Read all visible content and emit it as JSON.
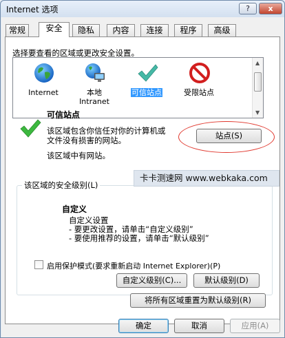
{
  "window": {
    "title": "Internet 选项",
    "help_label": "?",
    "close_label": "x"
  },
  "tabs": [
    {
      "label": "常规"
    },
    {
      "label": "安全",
      "active": true
    },
    {
      "label": "隐私"
    },
    {
      "label": "内容"
    },
    {
      "label": "连接"
    },
    {
      "label": "程序"
    },
    {
      "label": "高级"
    }
  ],
  "security": {
    "instruction": "选择要查看的区域或更改安全设置。",
    "zones": [
      {
        "icon": "globe-icon",
        "label": "Internet"
      },
      {
        "icon": "local-intranet-icon",
        "label": "本地\nIntranet"
      },
      {
        "icon": "checkmark-icon",
        "label": "可信站点",
        "selected": true
      },
      {
        "icon": "restricted-icon",
        "label": "受限站点"
      }
    ],
    "zone_title": "可信站点",
    "zone_desc_line1": "该区域包含你信任对你的计算机或",
    "zone_desc_line2": "文件没有损害的网站。",
    "zone_has_sites": "该区域中有网站。",
    "sites_button": "站点(S)",
    "group_title": "该区域的安全级别(L)",
    "level_name": "自定义",
    "level_line1": "自定义设置",
    "level_line2": "- 要更改设置，请单击“自定义级别”",
    "level_line3": "- 要使用推荐的设置，请单击“默认级别”",
    "protected_mode_label": "启用保护模式(要求重新启动 Internet Explorer)(P)",
    "protected_mode_checked": false,
    "custom_level_button": "自定义级别(C)...",
    "default_level_button": "默认级别(D)",
    "reset_all_button": "将所有区域重置为默认级别(R)"
  },
  "watermark": "卡卡测速网 www.webkaka.com",
  "footer": {
    "ok_button": "确定",
    "cancel_button": "取消",
    "apply_button": "应用(A)"
  },
  "colors": {
    "selection": "#3399ff",
    "annotation_ellipse": "#e0362c",
    "check_green": "#2eaa44"
  }
}
